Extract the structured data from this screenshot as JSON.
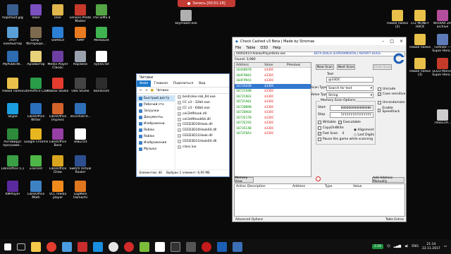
{
  "recording": {
    "label": "Запись [00:01:18]"
  },
  "desktop_icons": [
    {
      "label": "hojlefault.jpg",
      "color": "#3a5d8f"
    },
    {
      "label": "Viber",
      "color": "#7a4fc0"
    },
    {
      "label": "User",
      "color": "#e0b74c"
    },
    {
      "label": "Lenovo Photo Master",
      "color": "#c7392b"
    },
    {
      "label": "The SIMS 4",
      "color": "#55a446"
    },
    {
      "label": "Этот компьютер",
      "color": "#5aa0d8"
    },
    {
      "label": "Gimp - Фотореде...",
      "color": "#7d6a4f"
    },
    {
      "label": "SHAREit",
      "color": "#2b7fd4"
    },
    {
      "label": "AIMP",
      "color": "#e97a1f"
    },
    {
      "label": "MediaGet",
      "color": "#3fb34f"
    },
    {
      "label": "MyPublicW...",
      "color": "#2d6cb0"
    },
    {
      "label": "Архиватор",
      "color": "#e8d27a"
    },
    {
      "label": "Media Player Classic",
      "color": "#6c3fa0"
    },
    {
      "label": "Корзина",
      "color": "#9aa2ad"
    },
    {
      "label": "кукла.txt",
      "color": "#ffffff"
    },
    {
      "label": "Новая папка",
      "color": "#e8c04a"
    },
    {
      "label": "LibreOffice Calc",
      "color": "#2a9d48"
    },
    {
      "label": "Roblox Studio",
      "color": "#e33b2e"
    },
    {
      "label": "OBS Studio",
      "color": "#444444"
    },
    {
      "label": "Bandicam",
      "color": "#2d2d2d"
    },
    {
      "label": "Skype",
      "color": "#1a9ee0"
    },
    {
      "label": "LibreOffice Writer",
      "color": "#2a6fbd"
    },
    {
      "label": "LibreOffice Impress",
      "color": "#d3622b"
    },
    {
      "label": "301cd587d...",
      "color": "#2f6fb8"
    },
    {
      "label": "Антивирус программ...",
      "color": "#2d8a3a"
    },
    {
      "label": "Google Chrome",
      "color": "#e8b61f"
    },
    {
      "label": "LibreOffice Base",
      "color": "#963fa4"
    },
    {
      "label": "зевы.txt",
      "color": "#ffffff"
    },
    {
      "label": "LibreOffice 5.1",
      "color": "#3b9f46"
    },
    {
      "label": "uTorrent",
      "color": "#4fb648"
    },
    {
      "label": "LibreOffice Draw",
      "color": "#d9a51e"
    },
    {
      "label": "Switch Virtual Router",
      "color": "#2d4f8f"
    },
    {
      "label": "KMPlayer",
      "color": "#5b2a9c"
    },
    {
      "label": "LibreOffice Math",
      "color": "#3f82c4"
    },
    {
      "label": "VLC media player",
      "color": "#f08a1c"
    },
    {
      "label": "LogMeIn Hamachi",
      "color": "#e0761e"
    },
    {
      "label": "keymaker.exe",
      "color": "#b0b0b0"
    },
    {
      "label": "Новая папка (2)",
      "color": "#e8c04a"
    },
    {
      "label": "LTZ MONEY HACK",
      "color": "#e8c04a"
    },
    {
      "label": "WinRAR ZIP archive",
      "color": "#b24e9b"
    },
    {
      "label": "Новая папка",
      "color": "#e8c04a"
    },
    {
      "label": "Fortnite — Super Hero...",
      "color": "#5e7bb8"
    },
    {
      "label": "Новая папка (3)",
      "color": "#e8c04a"
    },
    {
      "label": "LEGO Marvel Super Hero...",
      "color": "#c53b2a"
    },
    {
      "label": "74SEE1A...",
      "color": "#cccccc"
    }
  ],
  "explorer": {
    "title": "Читики",
    "ribbon": [
      "Файл",
      "Главная",
      "Поделиться",
      "Вид"
    ],
    "address": "Читики",
    "nav": [
      "Быстрый досту",
      "Рабочий сто",
      "Загрузки",
      "Документы",
      "Изображени",
      "Roblox",
      "Roblox",
      "Изображения",
      "Музыка"
    ],
    "files": [
      "bsidrolex-rob_64.exe",
      "CC v3 - 32bit.exe",
      "CC v3 - 64bit.exe",
      "ceii3d9hook.dll",
      "ceii3d9hook64.dll",
      "CEED3D10Hook.dll",
      "CEED3D10Hook64.dll",
      "CEED3D11Hook.dll",
      "CEED3D11Hook64.dll",
      "class.lue"
    ],
    "status_items": "Элементов: 40",
    "status_selected": "Выбран 1 элемент: 6,95 МБ"
  },
  "cheat_engine": {
    "title": "Check Cashed v3 Beta | Made by Stromae",
    "menu": [
      "File",
      "Table",
      "D3D",
      "Help"
    ],
    "process": "00002610-RobloxPlayerBeta.exe",
    "build_notice": "BETA BUILD (EXPERIMENTAL) REPORT BUGS",
    "found": "Found: 3,980",
    "columns": [
      "Address",
      "Value",
      "Previous"
    ],
    "rows": [
      {
        "addr": "16440EFB",
        "value": "$33DC",
        "prev": ""
      },
      {
        "addr": "164F9603",
        "value": "$33DC",
        "prev": ""
      },
      {
        "addr": "164F9943",
        "value": "$33DC",
        "prev": ""
      },
      {
        "addr": "1672A438",
        "value": "$33DC",
        "prev": ""
      },
      {
        "addr": "1672C94B",
        "value": "$33DC",
        "prev": ""
      },
      {
        "addr": "1672C863",
        "value": "$33DC",
        "prev": ""
      },
      {
        "addr": "1672CA01",
        "value": "$33DC",
        "prev": ""
      },
      {
        "addr": "1672DB9B",
        "value": "$33DC",
        "prev": ""
      },
      {
        "addr": "1672DAE8",
        "value": "$33DC",
        "prev": ""
      },
      {
        "addr": "1672E17B",
        "value": "$33DC",
        "prev": ""
      },
      {
        "addr": "1672E293",
        "value": "$33DC",
        "prev": ""
      },
      {
        "addr": "1672EC4B",
        "value": "$33DC",
        "prev": ""
      },
      {
        "addr": "1672F8A3",
        "value": "$33DC",
        "prev": ""
      }
    ],
    "selected_row": 3,
    "new_scan": "New Scan",
    "next_scan": "Next Scan",
    "undo_scan": "Undo Scan",
    "text_label": "Text",
    "text_value": "@33DC",
    "scan_type_label": "Scan Type",
    "scan_type_value": "Search for text",
    "value_type_label": "Value Type",
    "value_type_value": "String",
    "unicode": "Unicode",
    "case_sensitive": "Case sensitive",
    "unrandomizer": "Unrandomizer",
    "enable_speedhack": "Enable Speedhack",
    "memory_options": "Memory Scan Options",
    "start_label": "Start",
    "start_value": "0000000000000000",
    "stop_label": "Stop",
    "stop_value": "7fffffffffffffff",
    "writable": "Writable",
    "executable": "Executable",
    "copyonwrite": "CopyOnWrite",
    "fast_scan": "Fast Scan",
    "fast_scan_value": "4",
    "alignment": "Alignment",
    "last_digits": "Last Digits",
    "pause_game": "Pause the game while scanning",
    "memory_view": "Memory View",
    "add_address": "Add Address Manually",
    "lower_cols": [
      "Active",
      "Description",
      "Address",
      "Type",
      "Value"
    ],
    "advanced": "Advanced Options",
    "table_extras": "Table Extras"
  },
  "taskbar": {
    "badge": "2:28",
    "lang": "ENG",
    "time": "21:14",
    "date": "22.11.2017"
  }
}
